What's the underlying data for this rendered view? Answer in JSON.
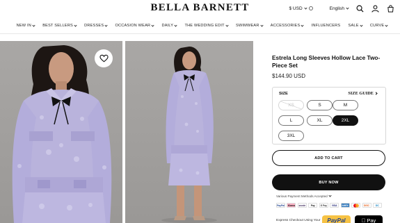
{
  "brand": {
    "logo_text": "BELLA BARNETT"
  },
  "header_right": {
    "currency": "$ USD",
    "language": "English"
  },
  "nav": {
    "items": [
      {
        "label": "NEW IN",
        "chevron": true
      },
      {
        "label": "BEST SELLERS",
        "chevron": true
      },
      {
        "label": "DRESSES",
        "chevron": true
      },
      {
        "label": "OCCASION WEAR",
        "chevron": true
      },
      {
        "label": "DAILY",
        "chevron": true
      },
      {
        "label": "THE WEDDING EDIT",
        "chevron": true
      },
      {
        "label": "SWIMWEAR",
        "chevron": true
      },
      {
        "label": "ACCESSORIES",
        "chevron": true
      },
      {
        "label": "INFLUENCERS",
        "chevron": false
      },
      {
        "label": "SALE",
        "chevron": true
      },
      {
        "label": "CURVE",
        "chevron": true
      }
    ]
  },
  "product": {
    "title": "Estrela Long Sleeves Hollow Lace Two-Piece Set",
    "price": "$144.90 USD",
    "size_label": "SIZE",
    "size_guide": "SIZE GUIDE",
    "sizes": [
      {
        "label": "XS",
        "state": "disabled"
      },
      {
        "label": "S",
        "state": "available"
      },
      {
        "label": "M",
        "state": "available"
      },
      {
        "label": "L",
        "state": "available"
      },
      {
        "label": "XL",
        "state": "available"
      },
      {
        "label": "2XL",
        "state": "selected"
      },
      {
        "label": "3XL",
        "state": "available"
      }
    ],
    "add_to_cart": "ADD TO CART",
    "buy_now": "BUY NOW",
    "payment_note": "Various Payment Methods Accepted",
    "express_checkout": "Express Checkout Using Your",
    "paypal": "PayPal",
    "apple_pay": "Pay"
  },
  "payment_icons": [
    {
      "name": "paypal-card-icon",
      "label": "PayPal",
      "color": "#ffffff",
      "text": "#1b3f8f"
    },
    {
      "name": "klarna-icon",
      "label": "Klarna",
      "color": "#ffb3c7",
      "text": "#111"
    },
    {
      "name": "sezzle-icon",
      "label": "sezzle",
      "color": "#ffffff",
      "text": "#392558"
    },
    {
      "name": "applepay-card-icon",
      "label": "Pay",
      "color": "#ffffff",
      "text": "#111"
    },
    {
      "name": "gpay-card-icon",
      "label": "G Pay",
      "color": "#ffffff",
      "text": "#333"
    },
    {
      "name": "visa-icon",
      "label": "VISA",
      "color": "#ffffff",
      "text": "#1a1f71"
    },
    {
      "name": "amex-icon",
      "label": "AMEX",
      "color": "#2e77bb",
      "text": "#ffffff"
    },
    {
      "name": "mastercard-icon",
      "label": "",
      "color": "#ffffff",
      "text": "#111"
    },
    {
      "name": "discover-icon",
      "label": "DISC",
      "color": "#ffffff",
      "text": "#e55b13"
    },
    {
      "name": "diners-icon",
      "label": "DC",
      "color": "#ffffff",
      "text": "#0079be"
    }
  ],
  "colors": {
    "accent_dark": "#111111",
    "lace_lavender": "#b9b3dc",
    "backdrop_gray": "#a3a19f",
    "paypal_yellow": "#f6c244"
  }
}
